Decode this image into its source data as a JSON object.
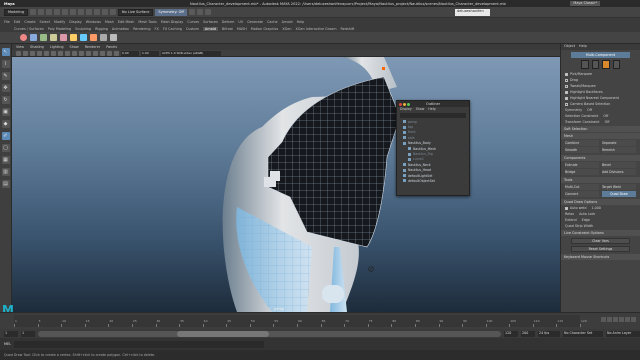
{
  "macbar": {
    "app": "Maya",
    "menus": [
      "File",
      "Edit",
      "Create",
      "Select",
      "Modify",
      "Display",
      "Windows",
      "Mesh",
      "Edit Mesh",
      "Mesh Tools",
      "Mesh Display",
      "Curves",
      "Surfaces",
      "Deform",
      "UV",
      "Generate",
      "Cache",
      "Arnold",
      "Help"
    ],
    "title": "Nautilus_Character_development.mb* - Autodesk MAYA 2022: /Users/deluxeshanifenapurrc/Project/Maya/Nautilus_project/Nautilus/scenes/Nautilus_Character_development.mb",
    "workspace": "Maya Classic*"
  },
  "status_line": {
    "mode": "Modeling",
    "live_surface": "No Live Surface",
    "symmetry": "Symmetry: Off",
    "sign_in": "deluxeshanifen"
  },
  "shelf_tabs": [
    "Curves / Surfaces",
    "Poly Modeling",
    "Sculpting",
    "Rigging",
    "Animation",
    "Rendering",
    "FX",
    "FX Caching",
    "Custom",
    "Arnold",
    "Bifrost",
    "MASH",
    "Motion Graphics",
    "XGen",
    "XGen Interactive Groom",
    "Redshift"
  ],
  "viewport": {
    "menus": [
      "View",
      "Shading",
      "Lighting",
      "Show",
      "Renderer",
      "Panels"
    ],
    "field1": "0.00",
    "field2": "1.00",
    "colorspace": "ACES 1.0 SDR-video (sRGB)",
    "camera": "persp"
  },
  "outliner": {
    "title": "Outliner",
    "menus": [
      "Display",
      "Show",
      "Help"
    ],
    "items": [
      {
        "label": "persp",
        "dim": true,
        "indent": false
      },
      {
        "label": "top",
        "dim": true,
        "indent": false
      },
      {
        "label": "front",
        "dim": true,
        "indent": false
      },
      {
        "label": "side",
        "dim": true,
        "indent": false
      },
      {
        "label": "Nautilus_Body",
        "dim": false,
        "indent": false
      },
      {
        "label": "Nautilus_Mesh",
        "dim": false,
        "indent": true
      },
      {
        "label": "Nautilus_Rig",
        "dim": true,
        "indent": true
      },
      {
        "label": "curve1",
        "dim": true,
        "indent": true
      },
      {
        "label": "Nautilus_Neck",
        "dim": false,
        "indent": false
      },
      {
        "label": "Nautilus_Head",
        "dim": false,
        "indent": false
      },
      {
        "label": "defaultLightSet",
        "dim": false,
        "indent": false
      },
      {
        "label": "defaultObjectSet",
        "dim": false,
        "indent": false
      }
    ]
  },
  "modeling_toolkit": {
    "menus": [
      "Object",
      "Help"
    ],
    "title": "Multi-Component",
    "selection_options": [
      {
        "label": "Pick/Marquee",
        "on": true
      },
      {
        "label": "Drag",
        "on": false
      },
      {
        "label": "Tweak/Marquee",
        "on": false
      },
      {
        "label": "Highlight Backfaces",
        "on": true
      },
      {
        "label": "Highlight Nearest Component",
        "on": true
      }
    ],
    "camera_based": "Camera Based Selection",
    "symmetry": "Symmetry",
    "selection_constraint": "Selection Constraint",
    "transform_constraint": "Transform Constraint",
    "off": "Off",
    "soft_selection": "Soft Selection",
    "mesh_header": "Mesh",
    "mesh_tools": [
      "Combine",
      "Separate",
      "Smooth",
      "Remesh"
    ],
    "components_header": "Components",
    "component_tools": [
      "Extrude",
      "Bevel",
      "Bridge",
      "Add Divisions"
    ],
    "tools_header": "Tools",
    "tools": [
      "Multi-Cut",
      "Target Weld",
      "Connect",
      "Quad Draw"
    ],
    "quad_draw_header": "Quad Draw Options",
    "auto_weld": "Auto weld",
    "auto_weld_value": "1.000",
    "relax": "Relax",
    "relax_value": "Auto Lock",
    "extend": "Extend",
    "extend_value": "Edge",
    "quad_strip_width": "Quad Strip Width",
    "live_constraint": "Live Constraint Options",
    "clear_vars": "Clear Vars",
    "reset_settings": "Reset Settings",
    "keyboard": "Keyboard Mouse Shortcuts"
  },
  "timeline": {
    "ticks": [
      "1",
      "5",
      "10",
      "15",
      "20",
      "25",
      "30",
      "35",
      "40",
      "45",
      "50",
      "55",
      "60",
      "65",
      "70",
      "75",
      "80",
      "85",
      "90",
      "95",
      "100",
      "105",
      "110",
      "115",
      "120"
    ],
    "current_frame": "1"
  },
  "range": {
    "start": "1",
    "inner_start": "1",
    "inner_end": "120",
    "end": "200",
    "fps": "24 fps",
    "char_set": "No Character Set",
    "anim_layer": "No Anim Layer"
  },
  "cmd": {
    "mel": "MEL"
  },
  "helpline": "Quad Draw Tool: Click to create a vertex. Shift+click to create polygon. Ctrl+click to delete."
}
